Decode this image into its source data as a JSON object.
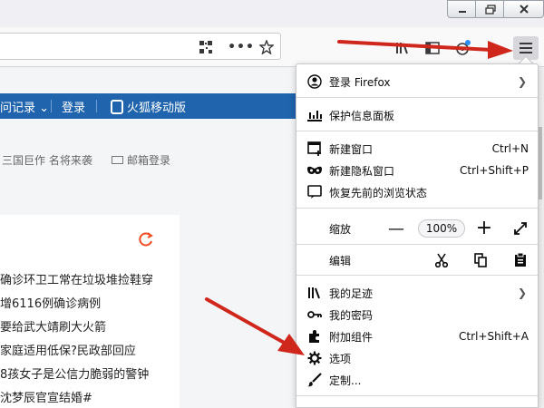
{
  "page": {
    "nav": {
      "history": "问记录",
      "login": "登录",
      "mobile": "火狐移动版"
    },
    "subline": {
      "promo": "三国巨作 名将来袭",
      "mail": "邮箱登录"
    },
    "news": [
      "确诊环卫工常在垃圾堆捡鞋穿",
      "增6116例确诊病例",
      "要给武大靖刷大火箭",
      "家庭适用低保?民政部回应",
      "8孩女子是公信力脆弱的警钟",
      "沈梦辰官宣结婚#"
    ]
  },
  "menu": {
    "signin": "登录 Firefox",
    "protections": "保护信息面板",
    "new_window": "新建窗口",
    "new_window_sc": "Ctrl+N",
    "private_window": "新建隐私窗口",
    "private_window_sc": "Ctrl+Shift+P",
    "restore": "恢复先前的浏览状态",
    "zoom_label": "缩放",
    "zoom_value": "100%",
    "zoom_minus": "—",
    "zoom_plus": "+",
    "edit_label": "编辑",
    "library": "我的足迹",
    "logins": "我的密码",
    "addons": "附加组件",
    "addons_sc": "Ctrl+Shift+A",
    "options": "选项",
    "customize": "定制..."
  },
  "colors": {
    "nav_blue": "#1f64ad",
    "arrow_red": "#d0271d",
    "refresh_orange": "#f04c23"
  }
}
